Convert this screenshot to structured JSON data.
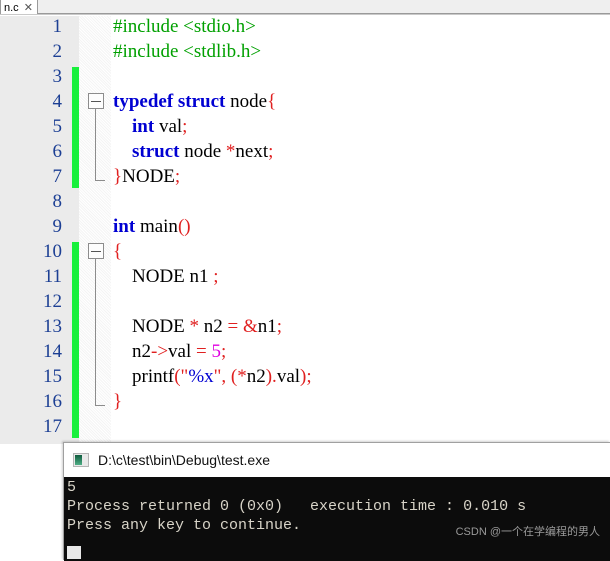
{
  "tab": {
    "label": "n.c",
    "close_icon": "✕"
  },
  "editor": {
    "line_numbers": [
      "1",
      "2",
      "3",
      "4",
      "5",
      "6",
      "7",
      "8",
      "9",
      "10",
      "11",
      "12",
      "13",
      "14",
      "15",
      "16",
      "17"
    ],
    "lines": [
      {
        "n": 1,
        "tokens": [
          {
            "t": "#include <stdio.h>",
            "c": "pre"
          }
        ]
      },
      {
        "n": 2,
        "tokens": [
          {
            "t": "#include <stdlib.h>",
            "c": "pre"
          }
        ]
      },
      {
        "n": 3,
        "tokens": []
      },
      {
        "n": 4,
        "tokens": [
          {
            "t": "typedef struct",
            "c": "kw"
          },
          {
            "t": " node",
            "c": "id"
          },
          {
            "t": "{",
            "c": "pun"
          }
        ]
      },
      {
        "n": 5,
        "tokens": [
          {
            "t": "    ",
            "c": "id"
          },
          {
            "t": "int",
            "c": "kw"
          },
          {
            "t": " val",
            "c": "id"
          },
          {
            "t": ";",
            "c": "pun"
          }
        ]
      },
      {
        "n": 6,
        "tokens": [
          {
            "t": "    ",
            "c": "id"
          },
          {
            "t": "struct",
            "c": "kw"
          },
          {
            "t": " node ",
            "c": "id"
          },
          {
            "t": "*",
            "c": "pun"
          },
          {
            "t": "next",
            "c": "id"
          },
          {
            "t": ";",
            "c": "pun"
          }
        ]
      },
      {
        "n": 7,
        "tokens": [
          {
            "t": "}",
            "c": "pun"
          },
          {
            "t": "NODE",
            "c": "id"
          },
          {
            "t": ";",
            "c": "pun"
          }
        ]
      },
      {
        "n": 8,
        "tokens": []
      },
      {
        "n": 9,
        "tokens": [
          {
            "t": "int",
            "c": "kw"
          },
          {
            "t": " main",
            "c": "id"
          },
          {
            "t": "()",
            "c": "pun"
          }
        ]
      },
      {
        "n": 10,
        "tokens": [
          {
            "t": "{",
            "c": "pun"
          }
        ]
      },
      {
        "n": 11,
        "tokens": [
          {
            "t": "    NODE n1 ",
            "c": "id"
          },
          {
            "t": ";",
            "c": "pun"
          }
        ]
      },
      {
        "n": 12,
        "tokens": []
      },
      {
        "n": 13,
        "tokens": [
          {
            "t": "    NODE ",
            "c": "id"
          },
          {
            "t": "*",
            "c": "pun"
          },
          {
            "t": " n2 ",
            "c": "id"
          },
          {
            "t": "=",
            "c": "pun"
          },
          {
            "t": " ",
            "c": "id"
          },
          {
            "t": "&",
            "c": "pun"
          },
          {
            "t": "n1",
            "c": "id"
          },
          {
            "t": ";",
            "c": "pun"
          }
        ]
      },
      {
        "n": 14,
        "tokens": [
          {
            "t": "    n2",
            "c": "id"
          },
          {
            "t": "->",
            "c": "pun"
          },
          {
            "t": "val ",
            "c": "id"
          },
          {
            "t": "=",
            "c": "pun"
          },
          {
            "t": " ",
            "c": "id"
          },
          {
            "t": "5",
            "c": "num"
          },
          {
            "t": ";",
            "c": "pun"
          }
        ]
      },
      {
        "n": 15,
        "tokens": [
          {
            "t": "    printf",
            "c": "id"
          },
          {
            "t": "(\"",
            "c": "pun"
          },
          {
            "t": "%x",
            "c": "str"
          },
          {
            "t": "\",",
            "c": "pun"
          },
          {
            "t": " ",
            "c": "id"
          },
          {
            "t": "(*",
            "c": "pun"
          },
          {
            "t": "n2",
            "c": "id"
          },
          {
            "t": ").",
            "c": "pun"
          },
          {
            "t": "val",
            "c": "id"
          },
          {
            "t": ");",
            "c": "pun"
          }
        ]
      },
      {
        "n": 16,
        "tokens": [
          {
            "t": "}",
            "c": "pun"
          }
        ]
      },
      {
        "n": 17,
        "tokens": []
      }
    ],
    "change_bars": [
      {
        "from_line": 3,
        "to_line": 7
      },
      {
        "from_line": 10,
        "to_line": 17
      }
    ],
    "fold_regions": [
      {
        "head_line": 4,
        "foot_line": 7
      },
      {
        "head_line": 10,
        "foot_line": 16
      }
    ]
  },
  "console": {
    "title": "D:\\c\\test\\bin\\Debug\\test.exe",
    "icon": "console-app-icon",
    "output": [
      "5",
      "Process returned 0 (0x0)   execution time : 0.010 s",
      "Press any key to continue."
    ],
    "watermark": "CSDN @一个在学编程的男人"
  },
  "colors": {
    "keyword": "#0000d2",
    "preprocessor": "#00a000",
    "punctuation": "#e02020",
    "string": "#0000d2",
    "number": "#e000e0",
    "line_number": "#1c3f94",
    "change_bar": "#18f03c",
    "console_bg": "#0c0c0c",
    "console_fg": "#d8d4c8"
  }
}
